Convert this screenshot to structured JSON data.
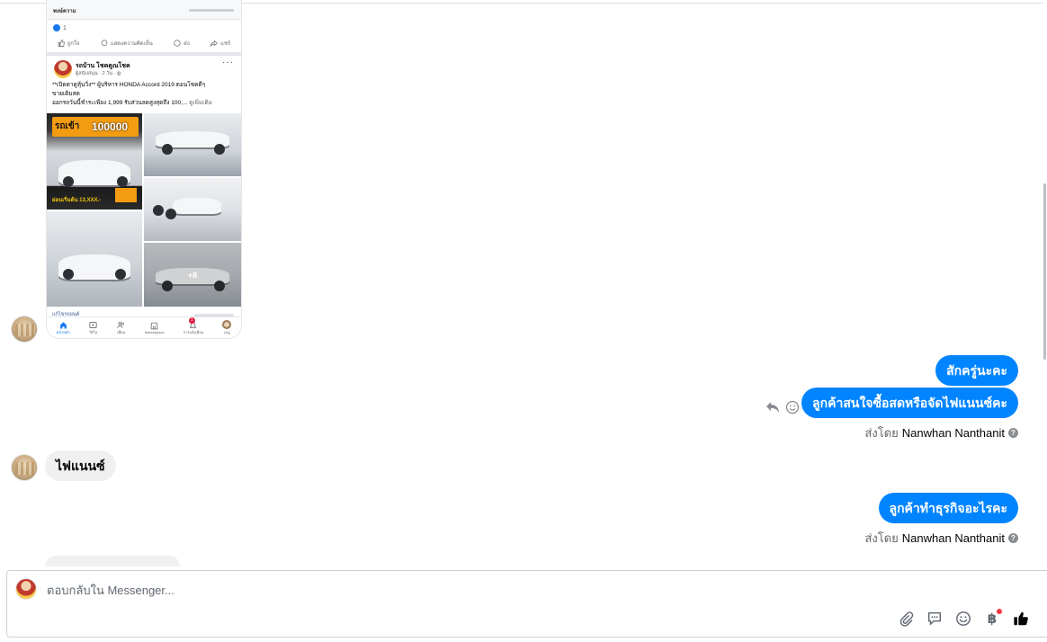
{
  "screenshot_post": {
    "prev_title": "พงษ์ความ",
    "like_count": "1",
    "actions": [
      "ถูกใจ",
      "แสดงความคิดเห็น",
      "ส่ง",
      "แชร์"
    ],
    "page_name": "รถบ้าน โชคคูณโชค",
    "page_meta": "ผู้สนับสนุน · 2 วัน · ",
    "post_line1": "**เปิดตาดูหุ้นวิ่ง** ผู้บริหาร HONDA Accord 2019 ตอนโชคดีๆ",
    "post_line2": "ขายเดิมสด",
    "post_line3": "ออกรถวันนี้ชำระเพียง 1,999 รับส่วนลดสูงสุดถึง 100,...",
    "see_more": "ดูเพิ่มเติม",
    "promo_text": "รถเข้า",
    "promo_amount": "100000",
    "promo_price": "ผ่อนเริ่มต้น 13,XXX.-",
    "more_photos": "+8",
    "below_text": "แก้ไขรถยนต์",
    "nav": [
      {
        "label": "หน้าหลัก",
        "icon": "home-icon"
      },
      {
        "label": "วิดีโอ",
        "icon": "video-icon"
      },
      {
        "label": "เพื่อน",
        "icon": "friends-icon"
      },
      {
        "label": "Marketplace",
        "icon": "marketplace-icon"
      },
      {
        "label": "การแจ้งเตือน",
        "icon": "bell-icon",
        "badge": "1"
      },
      {
        "label": "เมนู",
        "icon": "profile-icon"
      }
    ]
  },
  "messages": [
    {
      "side": "out",
      "text": "สักครู่นะคะ"
    },
    {
      "side": "out",
      "text": "ลูกค้าสนใจซื้อสดหรือจัดไฟแนนซ์คะ"
    },
    {
      "side": "in",
      "text": "ไฟแนนซ์"
    },
    {
      "side": "out",
      "text": "ลูกค้าทำธุรกิจอะไรคะ"
    }
  ],
  "sent_by": {
    "prefix": "ส่งโดย",
    "name": "Nanwhan Nanthanit"
  },
  "composer": {
    "placeholder": "ตอบกลับใน Messenger...",
    "tools": [
      "attach-icon",
      "saved-replies-icon",
      "emoji-icon",
      "baht-payment-icon",
      "like-icon"
    ],
    "baht_symbol": "฿"
  },
  "colors": {
    "outgoing_bubble": "#0084ff",
    "incoming_bubble": "#f0f0f0",
    "accent": "#1877f2"
  }
}
